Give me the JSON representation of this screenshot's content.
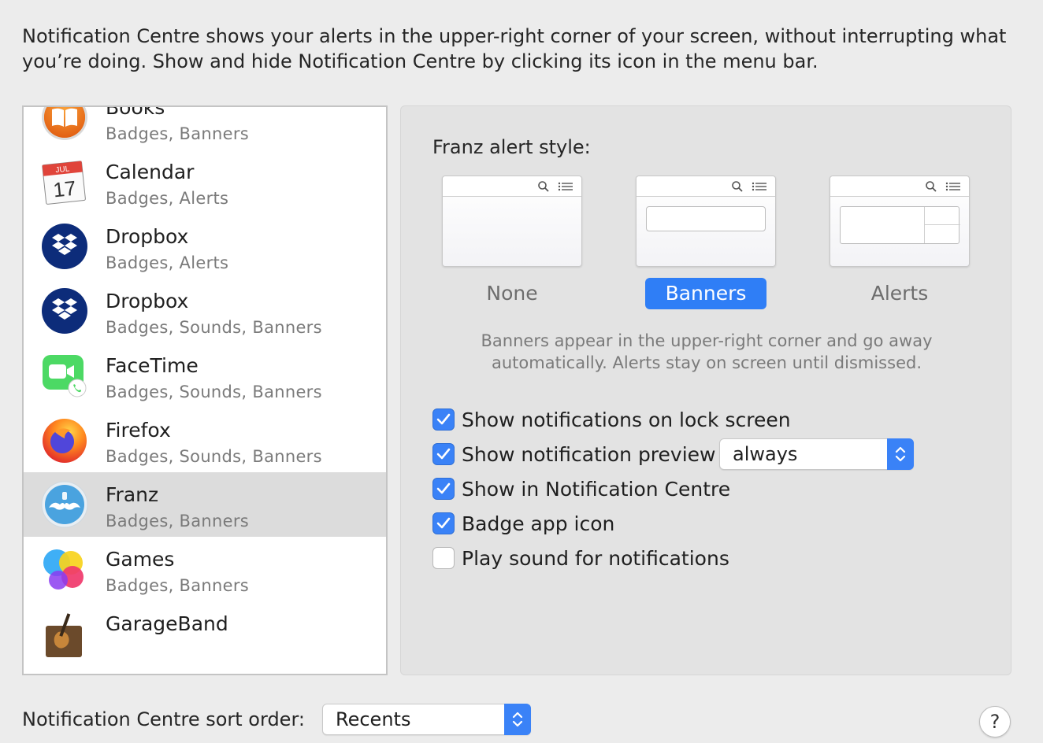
{
  "intro_text": "Notification Centre shows your alerts in the upper-right corner of your screen, without interrupting what you’re doing. Show and hide Notification Centre by clicking its icon in the menu bar.",
  "apps": [
    {
      "name": "Books",
      "detail": "Badges, Banners",
      "icon": "books-icon"
    },
    {
      "name": "Calendar",
      "detail": "Badges, Alerts",
      "icon": "calendar-icon",
      "calendar_month": "JUL",
      "calendar_day": "17"
    },
    {
      "name": "Dropbox",
      "detail": "Badges, Alerts",
      "icon": "dropbox-icon"
    },
    {
      "name": "Dropbox",
      "detail": "Badges, Sounds, Banners",
      "icon": "dropbox-icon"
    },
    {
      "name": "FaceTime",
      "detail": "Badges, Sounds, Banners",
      "icon": "facetime-icon"
    },
    {
      "name": "Firefox",
      "detail": "Badges, Sounds, Banners",
      "icon": "firefox-icon"
    },
    {
      "name": "Franz",
      "detail": "Badges, Banners",
      "icon": "franz-icon",
      "selected": true
    },
    {
      "name": "Games",
      "detail": "Badges, Banners",
      "icon": "games-icon"
    },
    {
      "name": "GarageBand",
      "detail": "",
      "icon": "garageband-icon"
    }
  ],
  "panel": {
    "alert_style_title": "Franz alert style:",
    "styles": [
      {
        "label": "None",
        "active": false
      },
      {
        "label": "Banners",
        "active": true
      },
      {
        "label": "Alerts",
        "active": false
      }
    ],
    "style_description": "Banners appear in the upper-right corner and go away automatically. Alerts stay on screen until dismissed.",
    "options": [
      {
        "label": "Show notifications on lock screen",
        "checked": true
      },
      {
        "label": "Show notification preview",
        "checked": true
      },
      {
        "label": "Show in Notification Centre",
        "checked": true
      },
      {
        "label": "Badge app icon",
        "checked": true
      },
      {
        "label": "Play sound for notifications",
        "checked": false
      }
    ],
    "preview_select_value": "always"
  },
  "sort_order": {
    "label": "Notification Centre sort order:",
    "value": "Recents"
  },
  "help_label": "?",
  "colors": {
    "accent": "#2f7ef6",
    "checkbox": "#3a82f7",
    "selected_row": "#dcdcdc",
    "background": "#ececec"
  }
}
